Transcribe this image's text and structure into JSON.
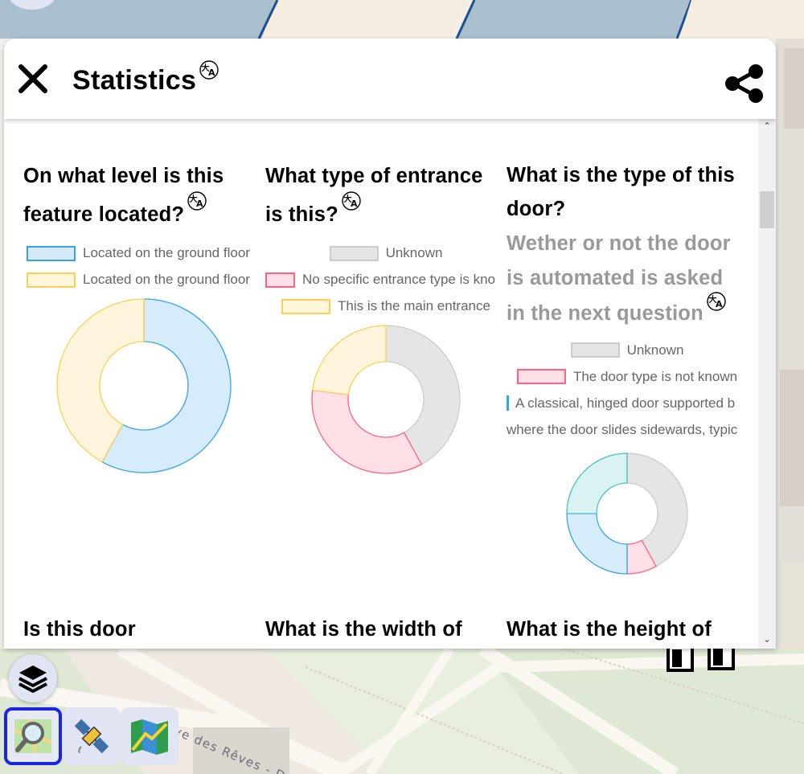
{
  "panel": {
    "title": "Statistics"
  },
  "map": {
    "street_label": "Drève des Rêves - Dromend"
  },
  "icons": {
    "close": "close-icon",
    "translate": "translate-icon",
    "share": "share-icon",
    "layers": "layers-icon"
  },
  "stats": [
    {
      "question_l1": "On what level is this",
      "question_l2": "feature located?",
      "legend": [
        {
          "label": "Located on the ground floor",
          "fill": "#d6eaf8",
          "stroke": "#36a2eb"
        },
        {
          "label": "Located on the ground floor",
          "fill": "#fff6dc",
          "stroke": "#ffce56"
        }
      ]
    },
    {
      "question_l1": "What type of entrance",
      "question_l2": "is this?",
      "legend": [
        {
          "label": "Unknown",
          "fill": "#e5e5e5",
          "stroke": "#cccccc"
        },
        {
          "label": "No specific entrance type is kno",
          "fill": "#ffe0e6",
          "stroke": "#ff6384"
        },
        {
          "label": "This is the main entrance",
          "fill": "#fff6dc",
          "stroke": "#ffce56"
        }
      ]
    },
    {
      "question_l1": "What is the type of this",
      "question_l2": "door?",
      "sub_l1": "Wether or not the door",
      "sub_l2": "is automated is asked",
      "sub_l3": "in the next question",
      "legend": [
        {
          "label": "Unknown",
          "fill": "#e5e5e5",
          "stroke": "#cccccc"
        },
        {
          "label": "The door type is not known",
          "fill": "#ffe0e6",
          "stroke": "#ff6384"
        },
        {
          "label": "A classical, hinged door supported b",
          "fill": "#d6eaf8",
          "stroke": "#36a2eb"
        },
        {
          "label": "where the door slides sidewards, typic",
          "fill": "#d9f2f2",
          "stroke": "#4bc0c0"
        }
      ]
    },
    {
      "question_l1": "Is this door"
    },
    {
      "question_l1": "What is the width of"
    },
    {
      "question_l1": "What is the height of"
    }
  ],
  "chart_data": [
    {
      "type": "pie",
      "categories": [
        "Located on the ground floor",
        "Located on the ground floor"
      ],
      "values": [
        58,
        42
      ],
      "colors": [
        "#36a2eb",
        "#ffce56"
      ]
    },
    {
      "type": "pie",
      "categories": [
        "Unknown",
        "No specific entrance type is kno",
        "This is the main entrance"
      ],
      "values": [
        42,
        35,
        23
      ],
      "colors": [
        "#cccccc",
        "#ff6384",
        "#ffce56"
      ]
    },
    {
      "type": "pie",
      "categories": [
        "Unknown",
        "The door type is not known",
        "A classical, hinged door supported b",
        "where the door slides sidewards, typic"
      ],
      "values": [
        42,
        8,
        25,
        25
      ],
      "colors": [
        "#cccccc",
        "#ff6384",
        "#36a2eb",
        "#4bc0c0"
      ]
    }
  ]
}
